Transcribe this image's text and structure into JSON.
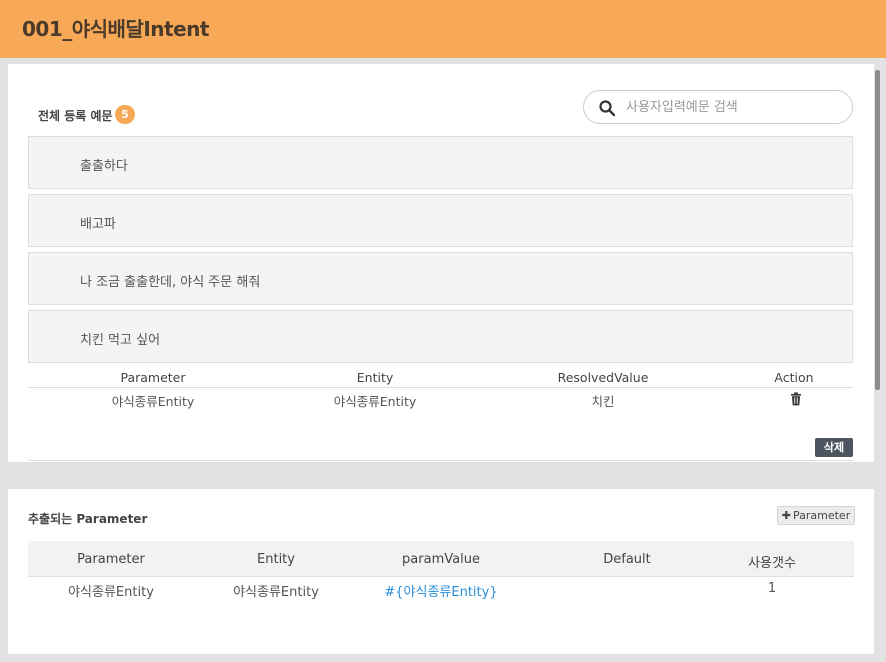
{
  "header": {
    "title": "001_야식배달Intent"
  },
  "examples": {
    "label": "전체 등록 예문",
    "count": "5",
    "search_placeholder": "사용자입력예문 검색",
    "items": [
      "출출하다",
      "배고파",
      "나 조금 출출한데, 야식 주문 해줘",
      "치킨 먹고 싶어"
    ],
    "table": {
      "headers": [
        "Parameter",
        "Entity",
        "ResolvedValue",
        "Action"
      ],
      "rows": [
        {
          "parameter": "야식종류Entity",
          "entity": "야식종류Entity",
          "resolved": "치킨",
          "action_icon": "trash-icon"
        }
      ]
    },
    "delete_label": "삭제"
  },
  "extracted": {
    "title": "추출되는 Parameter",
    "add_label": "Parameter",
    "headers": [
      "Parameter",
      "Entity",
      "paramValue",
      "Default",
      "사용갯수"
    ],
    "rows": [
      {
        "parameter": "야식종류Entity",
        "entity": "야식종류Entity",
        "param_value": "#{야식종류Entity}",
        "default": "",
        "count": "1"
      }
    ]
  },
  "colors": {
    "accent": "#f7a958",
    "link": "#2b8fd8",
    "button_dark": "#4d5660"
  }
}
